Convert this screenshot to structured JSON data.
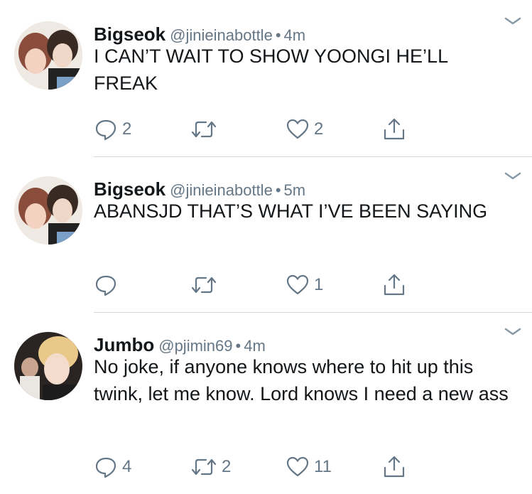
{
  "tweets": [
    {
      "name": "Bigseok",
      "handle": "@jinieinabottle",
      "separator": "•",
      "time": "4m",
      "text": "I CAN’T WAIT TO SHOW YOONGI HE’LL FREAK",
      "replies": "2",
      "retweets": "",
      "likes": "2"
    },
    {
      "name": "Bigseok",
      "handle": "@jinieinabottle",
      "separator": "•",
      "time": "5m",
      "text": "ABANSJD THAT’S WHAT I’VE BEEN SAYING",
      "replies": "",
      "retweets": "",
      "likes": "1"
    },
    {
      "name": "Jumbo",
      "handle": "@pjimin69",
      "separator": "•",
      "time": "4m",
      "text": "No joke, if anyone knows where to hit up this twink, let me know. Lord knows I need a new ass",
      "replies": "4",
      "retweets": "2",
      "likes": "11"
    }
  ],
  "icons": {
    "reply": "reply-icon",
    "retweet": "retweet-icon",
    "like": "heart-icon",
    "share": "share-icon",
    "more": "chevron-down-icon"
  },
  "colors": {
    "text": "#14171a",
    "secondary": "#657786",
    "divider": "#cfd6dc"
  }
}
